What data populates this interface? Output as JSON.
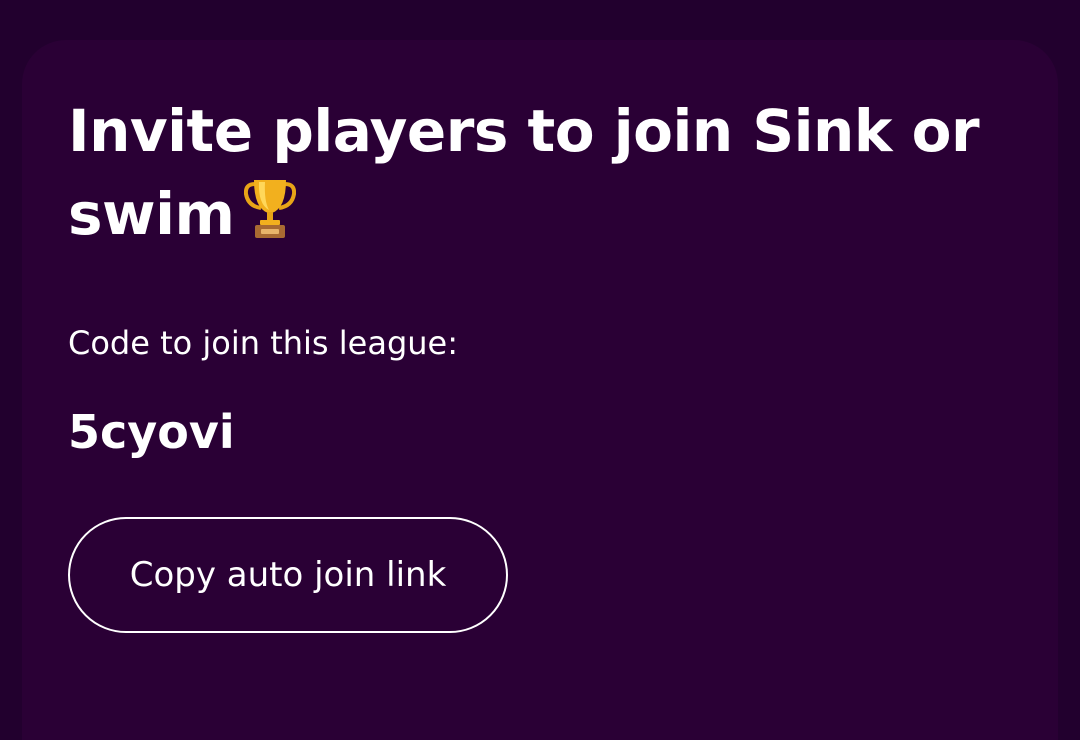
{
  "invite": {
    "title": "Invite players to join Sink or swim",
    "title_icon": "trophy-icon",
    "code_label": "Code to join this league:",
    "code_value": "5cyovi",
    "copy_button_label": "Copy auto join link"
  },
  "colors": {
    "page_background": "#22002e",
    "card_background": "#2a0035",
    "text": "#ffffff",
    "trophy_gold": "#f2b01e",
    "trophy_base": "#a86a32"
  }
}
